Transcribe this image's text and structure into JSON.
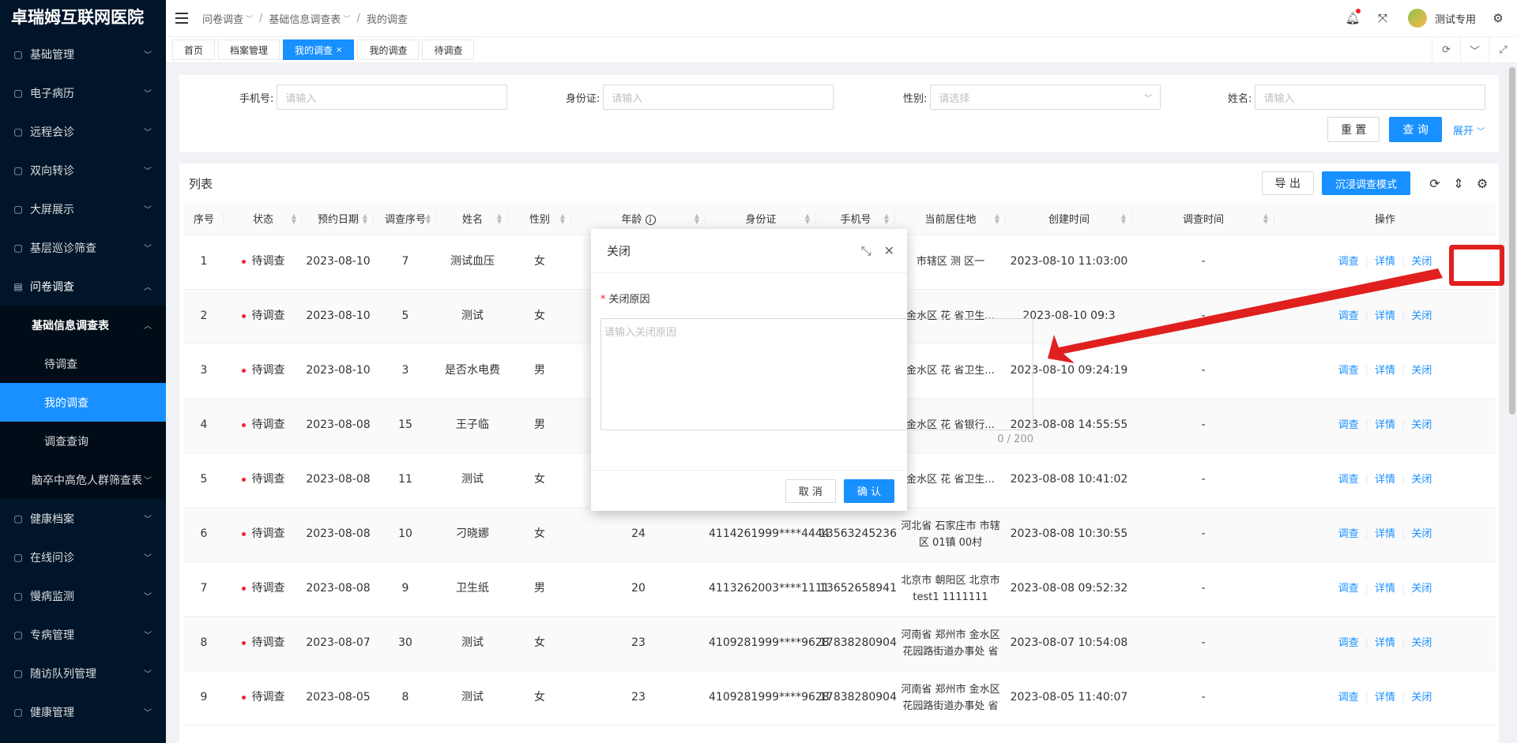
{
  "app": {
    "title": "卓瑞姆互联网医院"
  },
  "sidebar": {
    "items": [
      {
        "label": "基础管理",
        "icon": "dashboard-icon"
      },
      {
        "label": "电子病历",
        "icon": "record-icon"
      },
      {
        "label": "远程会诊",
        "icon": "branch-icon"
      },
      {
        "label": "双向转诊",
        "icon": "share-icon"
      },
      {
        "label": "大屏展示",
        "icon": "screen-icon"
      },
      {
        "label": "基层巡诊筛查",
        "icon": "dashboard-icon"
      },
      {
        "label": "问卷调查",
        "icon": "survey-icon"
      }
    ],
    "survey_sub": {
      "label": "基础信息调查表",
      "children": [
        "待调查",
        "我的调查",
        "调查查询"
      ]
    },
    "stroke": "脑卒中高危人群筛查表",
    "items_after": [
      {
        "label": "健康档案",
        "icon": "record-icon"
      },
      {
        "label": "在线问诊",
        "icon": "send-icon"
      },
      {
        "label": "慢病监测",
        "icon": "monitor-icon"
      },
      {
        "label": "专病管理",
        "icon": "gift-icon"
      },
      {
        "label": "随访队列管理",
        "icon": "grid-icon"
      },
      {
        "label": "健康管理",
        "icon": "shield-icon"
      }
    ]
  },
  "header": {
    "crumbs": [
      "问卷调查",
      "基础信息调查表",
      "我的调查"
    ],
    "user": "测试专用"
  },
  "tabs": [
    {
      "label": "首页",
      "active": false
    },
    {
      "label": "档案管理",
      "active": false
    },
    {
      "label": "我的调查",
      "active": true,
      "close": "×"
    },
    {
      "label": "我的调查",
      "active": false
    },
    {
      "label": "待调查",
      "active": false
    }
  ],
  "search": {
    "phone_label": "手机号:",
    "phone_ph": "请输入",
    "id_label": "身份证:",
    "id_ph": "请输入",
    "gender_label": "性别:",
    "gender_ph": "请选择",
    "name_label": "姓名:",
    "name_ph": "请输入",
    "reset": "重 置",
    "query": "查 询",
    "expand": "展开"
  },
  "list": {
    "title": "列表",
    "export": "导 出",
    "immersive": "沉浸调查模式",
    "columns": [
      "序号",
      "状态",
      "预约日期",
      "调查序号",
      "姓名",
      "性别",
      "年龄",
      "身份证",
      "手机号",
      "当前居住地",
      "创建时间",
      "调查时间",
      "操作"
    ],
    "op_labels": [
      "调查",
      "详情",
      "关闭"
    ],
    "rows": [
      {
        "no": "1",
        "status": "待调查",
        "date": "2023-08-10",
        "seq": "7",
        "name": "测试血压",
        "gender": "女",
        "age": "",
        "id": "",
        "phone": "",
        "addr": "市辖区 测 区一",
        "created": "2023-08-10 11:03:00",
        "surveyed": "-"
      },
      {
        "no": "2",
        "status": "待调查",
        "date": "2023-08-10",
        "seq": "5",
        "name": "测试",
        "gender": "女",
        "age": "",
        "id": "",
        "phone": "",
        "addr": "金水区 花 省卫生...",
        "created": "2023-08-10 09:3",
        "surveyed": "-"
      },
      {
        "no": "3",
        "status": "待调查",
        "date": "2023-08-10",
        "seq": "3",
        "name": "是否水电费",
        "gender": "男",
        "age": "",
        "id": "",
        "phone": "",
        "addr": "金水区 花 省卫生...",
        "created": "2023-08-10 09:24:19",
        "surveyed": "-"
      },
      {
        "no": "4",
        "status": "待调查",
        "date": "2023-08-08",
        "seq": "15",
        "name": "王子临",
        "gender": "男",
        "age": "",
        "id": "",
        "phone": "",
        "addr": "金水区 花 省银行...",
        "created": "2023-08-08 14:55:55",
        "surveyed": "-"
      },
      {
        "no": "5",
        "status": "待调查",
        "date": "2023-08-08",
        "seq": "11",
        "name": "测试",
        "gender": "女",
        "age": "",
        "id": "",
        "phone": "",
        "addr": "金水区 花 省卫生...",
        "created": "2023-08-08 10:41:02",
        "surveyed": "-"
      },
      {
        "no": "6",
        "status": "待调查",
        "date": "2023-08-08",
        "seq": "10",
        "name": "刁晓娜",
        "gender": "女",
        "age": "24",
        "id": "4114261999****4444",
        "phone": "13563245236",
        "addr": "河北省 石家庄市 市辖区 01镇 00村",
        "created": "2023-08-08 10:30:55",
        "surveyed": "-"
      },
      {
        "no": "7",
        "status": "待调查",
        "date": "2023-08-08",
        "seq": "9",
        "name": "卫生纸",
        "gender": "男",
        "age": "20",
        "id": "4113262003****1111",
        "phone": "13652658941",
        "addr": "北京市 朝阳区 北京市 test1 1111111",
        "created": "2023-08-08 09:52:32",
        "surveyed": "-"
      },
      {
        "no": "8",
        "status": "待调查",
        "date": "2023-08-07",
        "seq": "30",
        "name": "测试",
        "gender": "女",
        "age": "23",
        "id": "4109281999****9628",
        "phone": "17838280904",
        "addr": "河南省 郑州市 金水区 花园路街道办事处 省卫生...",
        "created": "2023-08-07 10:54:08",
        "surveyed": "-"
      },
      {
        "no": "9",
        "status": "待调查",
        "date": "2023-08-05",
        "seq": "8",
        "name": "测试",
        "gender": "女",
        "age": "23",
        "id": "4109281999****9628",
        "phone": "17838280904",
        "addr": "河南省 郑州市 金水区 花园路街道办事处 省卫生...",
        "created": "2023-08-05 11:40:07",
        "surveyed": "-"
      }
    ]
  },
  "modal": {
    "title": "关闭",
    "required_mark": "*",
    "label": "关闭原因",
    "placeholder": "请输入关闭原因",
    "counter": "0 / 200",
    "cancel": "取 消",
    "confirm": "确 认"
  },
  "colors": {
    "primary": "#1890ff",
    "sidebar": "#001529",
    "annotation": "#e0201f"
  }
}
